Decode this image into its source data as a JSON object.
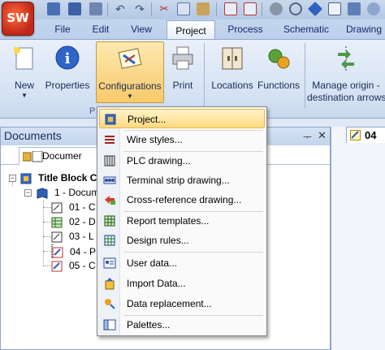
{
  "app": {
    "logo_text": "SW"
  },
  "tabs": [
    {
      "label": "File"
    },
    {
      "label": "Edit"
    },
    {
      "label": "View"
    },
    {
      "label": "Project",
      "active": true
    },
    {
      "label": "Process"
    },
    {
      "label": "Schematic"
    },
    {
      "label": "Drawing"
    }
  ],
  "ribbon": {
    "buttons": {
      "new": {
        "label": "New",
        "icon": "new-document-icon",
        "has_dropdown": true
      },
      "properties": {
        "label": "Properties",
        "icon": "info-icon"
      },
      "configurations": {
        "label": "Configurations",
        "icon": "configurations-icon",
        "has_dropdown": true,
        "pressed": true
      },
      "print": {
        "label": "Print",
        "icon": "printer-icon"
      },
      "locations": {
        "label": "Locations",
        "icon": "locations-icon"
      },
      "functions": {
        "label": "Functions",
        "icon": "functions-icon"
      },
      "manage_origin": {
        "label_line1": "Manage origin -",
        "label_line2": "destination arrows",
        "icon": "origin-destination-arrows-icon"
      }
    },
    "group_label": "P"
  },
  "documents": {
    "title": "Documents",
    "tab_label": "Documer",
    "tree": {
      "root": "Title Block C",
      "book": "1 - Docum",
      "items": [
        {
          "label": "01 - C",
          "icon": "drawing-sheet-icon"
        },
        {
          "label": "02 - D",
          "icon": "report-table-icon"
        },
        {
          "label": "03 - L",
          "icon": "drawing-sheet-icon"
        },
        {
          "label": "04 - P",
          "icon": "scheme-sheet-icon"
        },
        {
          "label": "05 - C",
          "icon": "scheme-sheet-icon"
        }
      ]
    }
  },
  "right_tab": {
    "label": "04"
  },
  "menu": {
    "items": [
      {
        "label": "Project...",
        "icon": "project-config-icon",
        "highlighted": true
      },
      {
        "label": "Wire styles...",
        "icon": "wire-styles-icon"
      },
      {
        "label": "PLC drawing...",
        "icon": "plc-drawing-icon"
      },
      {
        "label": "Terminal strip drawing...",
        "icon": "terminal-strip-icon"
      },
      {
        "label": "Cross-reference drawing...",
        "icon": "cross-reference-icon"
      },
      {
        "label": "Report templates...",
        "icon": "report-templates-icon"
      },
      {
        "label": "Design rules...",
        "icon": "design-rules-icon"
      },
      {
        "label": "User data...",
        "icon": "user-data-icon"
      },
      {
        "label": "Import Data...",
        "icon": "import-data-icon"
      },
      {
        "label": "Data replacement...",
        "icon": "data-replacement-icon"
      },
      {
        "label": "Palettes...",
        "icon": "palettes-icon"
      }
    ]
  }
}
